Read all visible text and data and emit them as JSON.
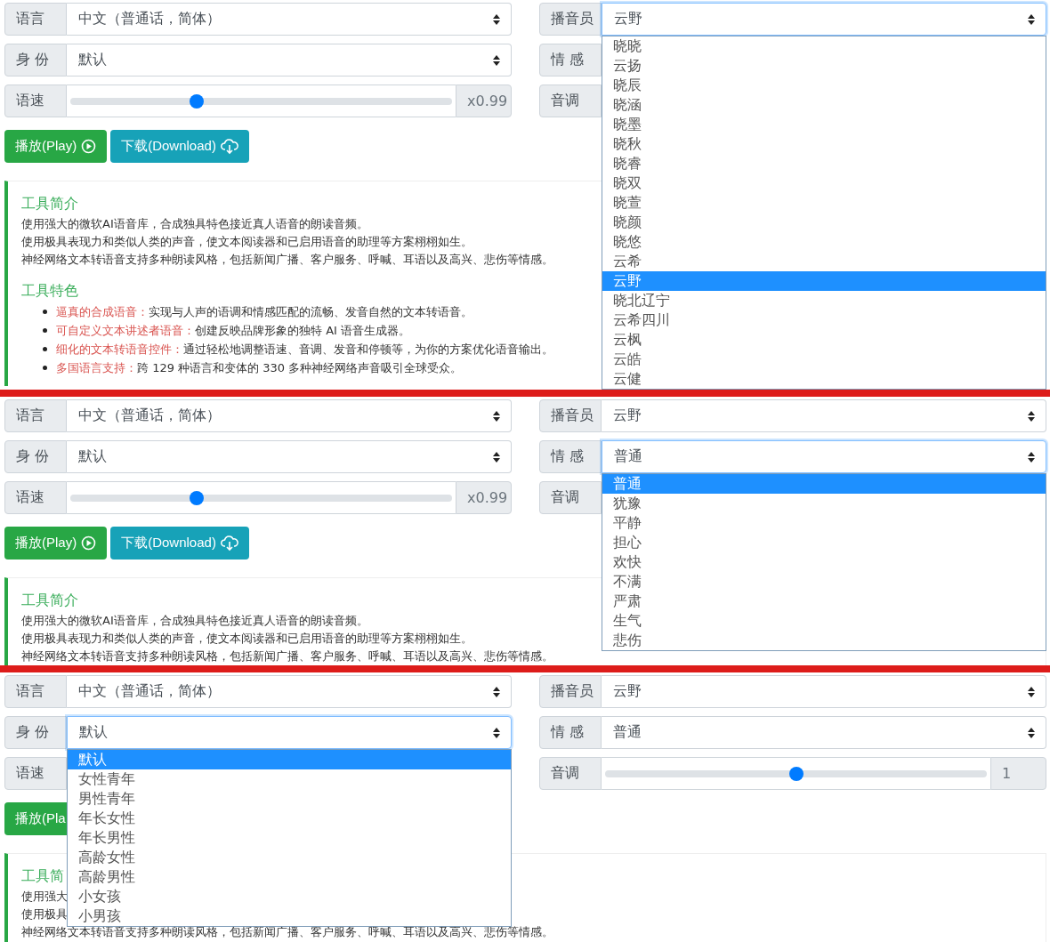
{
  "panels": [
    {
      "left": [
        {
          "label": "语言",
          "kind": "select",
          "value": "中文（普通话，简体）",
          "open": false
        },
        {
          "label": "身 份",
          "kind": "select",
          "value": "默认",
          "open": false
        },
        {
          "label": "语速",
          "kind": "slider",
          "level": 0.33,
          "reading": "x0.99"
        }
      ],
      "buttons": [
        {
          "kind": "play",
          "label": "播放(Play)",
          "icon": true
        },
        {
          "kind": "download",
          "label": "下载(Download)",
          "icon": true
        }
      ],
      "card": {
        "intro_title": "工具简介",
        "intro_lines": [
          "使用强大的微软AI语音库，合成独具特色接近真人语音的朗读音频。",
          "使用极具表现力和类似人类的声音，使文本阅读器和已启用语音的助理等方案栩栩如生。",
          "神经网络文本转语音支持多种朗读风格，包括新闻广播、客户服务、呼喊、耳语以及高兴、悲伤等情感。"
        ],
        "features_title": "工具特色",
        "features": [
          {
            "term": "逼真的合成语音：",
            "text": "实现与人声的语调和情感匹配的流畅、发音自然的文本转语音。"
          },
          {
            "term": "可自定义文本讲述者语音：",
            "text": "创建反映品牌形象的独特 AI 语音生成器。"
          },
          {
            "term": "细化的文本转语音控件：",
            "text": "通过轻松地调整语速、音调、发音和停顿等，为你的方案优化语音输出。"
          },
          {
            "term": "多国语言支持：",
            "text": "跨 129 种语言和变体的 330 多种神经网络声音吸引全球受众。"
          }
        ]
      },
      "right": [
        {
          "label": "播音员",
          "kind": "select",
          "value": "云野",
          "open": true,
          "options": [
            {
              "text": "晓晓",
              "selected": false
            },
            {
              "text": "云扬",
              "selected": false
            },
            {
              "text": "晓辰",
              "selected": false
            },
            {
              "text": "晓涵",
              "selected": false
            },
            {
              "text": "晓墨",
              "selected": false
            },
            {
              "text": "晓秋",
              "selected": false
            },
            {
              "text": "晓睿",
              "selected": false
            },
            {
              "text": "晓双",
              "selected": false
            },
            {
              "text": "晓萱",
              "selected": false
            },
            {
              "text": "晓颜",
              "selected": false
            },
            {
              "text": "晓悠",
              "selected": false
            },
            {
              "text": "云希",
              "selected": false
            },
            {
              "text": "云野",
              "selected": true
            },
            {
              "text": "晓北辽宁",
              "selected": false
            },
            {
              "text": "云希四川",
              "selected": false
            },
            {
              "text": "云枫",
              "selected": false
            },
            {
              "text": "云皓",
              "selected": false
            },
            {
              "text": "云健",
              "selected": false
            }
          ]
        },
        {
          "label": "情 感",
          "kind": "covered"
        },
        {
          "label": "音调",
          "kind": "covered"
        }
      ]
    },
    {
      "left": [
        {
          "label": "语言",
          "kind": "select",
          "value": "中文（普通话，简体）",
          "open": false
        },
        {
          "label": "身 份",
          "kind": "select",
          "value": "默认",
          "open": false
        },
        {
          "label": "语速",
          "kind": "slider",
          "level": 0.33,
          "reading": "x0.99"
        }
      ],
      "buttons": [
        {
          "kind": "play",
          "label": "播放(Play)",
          "icon": true
        },
        {
          "kind": "download",
          "label": "下载(Download)",
          "icon": true
        }
      ],
      "card": {
        "intro_title": "工具简介",
        "intro_lines": [
          "使用强大的微软AI语音库，合成独具特色接近真人语音的朗读音频。",
          "使用极具表现力和类似人类的声音，使文本阅读器和已启用语音的助理等方案栩栩如生。",
          "神经网络文本转语音支持多种朗读风格，包括新闻广播、客户服务、呼喊、耳语以及高兴、悲伤等情感。"
        ]
      },
      "right": [
        {
          "label": "播音员",
          "kind": "select",
          "value": "云野",
          "open": false
        },
        {
          "label": "情 感",
          "kind": "select",
          "value": "普通",
          "open": true,
          "options": [
            {
              "text": "普通",
              "selected": true
            },
            {
              "text": "犹豫",
              "selected": false
            },
            {
              "text": "平静",
              "selected": false
            },
            {
              "text": "担心",
              "selected": false
            },
            {
              "text": "欢快",
              "selected": false
            },
            {
              "text": "不满",
              "selected": false
            },
            {
              "text": "严肃",
              "selected": false
            },
            {
              "text": "生气",
              "selected": false
            },
            {
              "text": "悲伤",
              "selected": false
            }
          ]
        },
        {
          "label": "音调",
          "kind": "covered"
        }
      ]
    },
    {
      "left": [
        {
          "label": "语言",
          "kind": "select",
          "value": "中文（普通话，简体）",
          "open": false
        },
        {
          "label": "身 份",
          "kind": "select",
          "value": "默认",
          "open": true,
          "options": [
            {
              "text": "默认",
              "selected": true
            },
            {
              "text": "女性青年",
              "selected": false
            },
            {
              "text": "男性青年",
              "selected": false
            },
            {
              "text": "年长女性",
              "selected": false
            },
            {
              "text": "年长男性",
              "selected": false
            },
            {
              "text": "高龄女性",
              "selected": false
            },
            {
              "text": "高龄男性",
              "selected": false
            },
            {
              "text": "小女孩",
              "selected": false
            },
            {
              "text": "小男孩",
              "selected": false
            }
          ]
        },
        {
          "label": "语速",
          "kind": "covered"
        }
      ],
      "buttons": [
        {
          "kind": "play",
          "label": "播放(Pla",
          "icon": false
        }
      ],
      "card": {
        "intro_title": "工具简",
        "intro_lines": [
          "使用强大",
          "使用极具",
          "神经网络文本转语音支持多种朗读风格，包括新闻广播、客户服务、呼喊、耳语以及高兴、悲伤等情感。"
        ]
      },
      "right": [
        {
          "label": "播音员",
          "kind": "select",
          "value": "云野",
          "open": false
        },
        {
          "label": "情 感",
          "kind": "select",
          "value": "普通",
          "open": false
        },
        {
          "label": "音调",
          "kind": "slider",
          "level": 0.5,
          "reading": "1"
        }
      ]
    }
  ]
}
